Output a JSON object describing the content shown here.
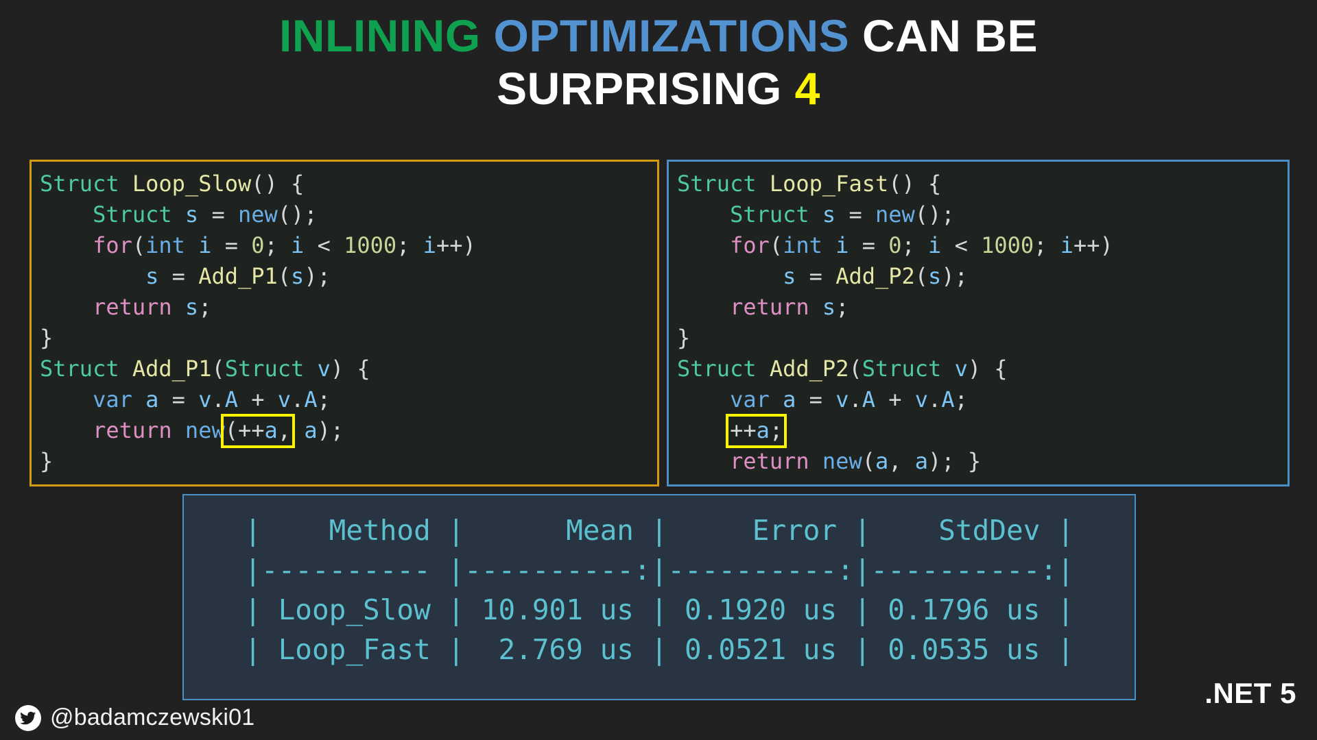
{
  "slide": {
    "title": {
      "line1_part1": "Inlining",
      "line1_part2": "Optimizations",
      "line1_part3": "Can Be",
      "line2_part1": "Surprising",
      "line2_part2": "4"
    },
    "colors": {
      "background": "#212121",
      "title_green": "#0fa14f",
      "title_blue": "#5292d0",
      "title_white": "#ffffff",
      "title_yellow": "#fcf500",
      "panel_left_border": "#d49a12",
      "panel_right_border": "#4a90c7",
      "highlight_box": "#fcf500",
      "table_text": "#5dc0cf",
      "table_background": "#283442"
    }
  },
  "left_panel": {
    "lines": [
      [
        {
          "t": "Struct",
          "c": "c-type"
        },
        {
          "t": " ",
          "c": "c-plain"
        },
        {
          "t": "Loop_Slow",
          "c": "c-fn"
        },
        {
          "t": "() {",
          "c": "c-punc"
        }
      ],
      [
        {
          "t": "    ",
          "c": "c-plain"
        },
        {
          "t": "Struct",
          "c": "c-type"
        },
        {
          "t": " ",
          "c": "c-plain"
        },
        {
          "t": "s",
          "c": "c-var"
        },
        {
          "t": " = ",
          "c": "c-punc"
        },
        {
          "t": "new",
          "c": "c-kw2"
        },
        {
          "t": "();",
          "c": "c-punc"
        }
      ],
      [
        {
          "t": "    ",
          "c": "c-plain"
        },
        {
          "t": "for",
          "c": "c-kw"
        },
        {
          "t": "(",
          "c": "c-punc"
        },
        {
          "t": "int",
          "c": "c-kw2"
        },
        {
          "t": " ",
          "c": "c-plain"
        },
        {
          "t": "i",
          "c": "c-var"
        },
        {
          "t": " = ",
          "c": "c-punc"
        },
        {
          "t": "0",
          "c": "c-num"
        },
        {
          "t": "; ",
          "c": "c-punc"
        },
        {
          "t": "i",
          "c": "c-var"
        },
        {
          "t": " < ",
          "c": "c-punc"
        },
        {
          "t": "1000",
          "c": "c-num"
        },
        {
          "t": "; ",
          "c": "c-punc"
        },
        {
          "t": "i",
          "c": "c-var"
        },
        {
          "t": "++)",
          "c": "c-punc"
        }
      ],
      [
        {
          "t": "        ",
          "c": "c-plain"
        },
        {
          "t": "s",
          "c": "c-var"
        },
        {
          "t": " = ",
          "c": "c-punc"
        },
        {
          "t": "Add_P1",
          "c": "c-fn"
        },
        {
          "t": "(",
          "c": "c-punc"
        },
        {
          "t": "s",
          "c": "c-var"
        },
        {
          "t": ");",
          "c": "c-punc"
        }
      ],
      [
        {
          "t": "    ",
          "c": "c-plain"
        },
        {
          "t": "return",
          "c": "c-kw"
        },
        {
          "t": " ",
          "c": "c-plain"
        },
        {
          "t": "s",
          "c": "c-var"
        },
        {
          "t": ";",
          "c": "c-punc"
        }
      ],
      [
        {
          "t": "}",
          "c": "c-punc"
        }
      ],
      [
        {
          "t": "Struct",
          "c": "c-type"
        },
        {
          "t": " ",
          "c": "c-plain"
        },
        {
          "t": "Add_P1",
          "c": "c-fn"
        },
        {
          "t": "(",
          "c": "c-punc"
        },
        {
          "t": "Struct",
          "c": "c-type"
        },
        {
          "t": " ",
          "c": "c-plain"
        },
        {
          "t": "v",
          "c": "c-var"
        },
        {
          "t": ") {",
          "c": "c-punc"
        }
      ],
      [
        {
          "t": "    ",
          "c": "c-plain"
        },
        {
          "t": "var",
          "c": "c-kw2"
        },
        {
          "t": " ",
          "c": "c-plain"
        },
        {
          "t": "a",
          "c": "c-var"
        },
        {
          "t": " = ",
          "c": "c-punc"
        },
        {
          "t": "v",
          "c": "c-var"
        },
        {
          "t": ".",
          "c": "c-punc"
        },
        {
          "t": "A",
          "c": "c-var"
        },
        {
          "t": " + ",
          "c": "c-punc"
        },
        {
          "t": "v",
          "c": "c-var"
        },
        {
          "t": ".",
          "c": "c-punc"
        },
        {
          "t": "A",
          "c": "c-var"
        },
        {
          "t": ";",
          "c": "c-punc"
        }
      ],
      [
        {
          "t": "    ",
          "c": "c-plain"
        },
        {
          "t": "return",
          "c": "c-kw"
        },
        {
          "t": " ",
          "c": "c-plain"
        },
        {
          "t": "new",
          "c": "c-kw2"
        },
        {
          "t": "(++",
          "c": "c-punc",
          "hl": "start"
        },
        {
          "t": "a",
          "c": "c-var",
          "hl": "mid"
        },
        {
          "t": ",",
          "c": "c-punc",
          "hl": "end"
        },
        {
          "t": " ",
          "c": "c-plain"
        },
        {
          "t": "a",
          "c": "c-var"
        },
        {
          "t": ");",
          "c": "c-punc"
        }
      ],
      [
        {
          "t": "}",
          "c": "c-punc"
        }
      ]
    ]
  },
  "right_panel": {
    "lines": [
      [
        {
          "t": "Struct",
          "c": "c-type"
        },
        {
          "t": " ",
          "c": "c-plain"
        },
        {
          "t": "Loop_Fast",
          "c": "c-fn"
        },
        {
          "t": "() {",
          "c": "c-punc"
        }
      ],
      [
        {
          "t": "    ",
          "c": "c-plain"
        },
        {
          "t": "Struct",
          "c": "c-type"
        },
        {
          "t": " ",
          "c": "c-plain"
        },
        {
          "t": "s",
          "c": "c-var"
        },
        {
          "t": " = ",
          "c": "c-punc"
        },
        {
          "t": "new",
          "c": "c-kw2"
        },
        {
          "t": "();",
          "c": "c-punc"
        }
      ],
      [
        {
          "t": "    ",
          "c": "c-plain"
        },
        {
          "t": "for",
          "c": "c-kw"
        },
        {
          "t": "(",
          "c": "c-punc"
        },
        {
          "t": "int",
          "c": "c-kw2"
        },
        {
          "t": " ",
          "c": "c-plain"
        },
        {
          "t": "i",
          "c": "c-var"
        },
        {
          "t": " = ",
          "c": "c-punc"
        },
        {
          "t": "0",
          "c": "c-num"
        },
        {
          "t": "; ",
          "c": "c-punc"
        },
        {
          "t": "i",
          "c": "c-var"
        },
        {
          "t": " < ",
          "c": "c-punc"
        },
        {
          "t": "1000",
          "c": "c-num"
        },
        {
          "t": "; ",
          "c": "c-punc"
        },
        {
          "t": "i",
          "c": "c-var"
        },
        {
          "t": "++)",
          "c": "c-punc"
        }
      ],
      [
        {
          "t": "        ",
          "c": "c-plain"
        },
        {
          "t": "s",
          "c": "c-var"
        },
        {
          "t": " = ",
          "c": "c-punc"
        },
        {
          "t": "Add_P2",
          "c": "c-fn"
        },
        {
          "t": "(",
          "c": "c-punc"
        },
        {
          "t": "s",
          "c": "c-var"
        },
        {
          "t": ");",
          "c": "c-punc"
        }
      ],
      [
        {
          "t": "    ",
          "c": "c-plain"
        },
        {
          "t": "return",
          "c": "c-kw"
        },
        {
          "t": " ",
          "c": "c-plain"
        },
        {
          "t": "s",
          "c": "c-var"
        },
        {
          "t": ";",
          "c": "c-punc"
        }
      ],
      [
        {
          "t": "}",
          "c": "c-punc"
        }
      ],
      [
        {
          "t": "Struct",
          "c": "c-type"
        },
        {
          "t": " ",
          "c": "c-plain"
        },
        {
          "t": "Add_P2",
          "c": "c-fn"
        },
        {
          "t": "(",
          "c": "c-punc"
        },
        {
          "t": "Struct",
          "c": "c-type"
        },
        {
          "t": " ",
          "c": "c-plain"
        },
        {
          "t": "v",
          "c": "c-var"
        },
        {
          "t": ") {",
          "c": "c-punc"
        }
      ],
      [
        {
          "t": "    ",
          "c": "c-plain"
        },
        {
          "t": "var",
          "c": "c-kw2"
        },
        {
          "t": " ",
          "c": "c-plain"
        },
        {
          "t": "a",
          "c": "c-var"
        },
        {
          "t": " = ",
          "c": "c-punc"
        },
        {
          "t": "v",
          "c": "c-var"
        },
        {
          "t": ".",
          "c": "c-punc"
        },
        {
          "t": "A",
          "c": "c-var"
        },
        {
          "t": " + ",
          "c": "c-punc"
        },
        {
          "t": "v",
          "c": "c-var"
        },
        {
          "t": ".",
          "c": "c-punc"
        },
        {
          "t": "A",
          "c": "c-var"
        },
        {
          "t": ";",
          "c": "c-punc"
        }
      ],
      [
        {
          "t": "    ",
          "c": "c-plain"
        },
        {
          "t": "++",
          "c": "c-punc",
          "hl": "start"
        },
        {
          "t": "a",
          "c": "c-var",
          "hl": "mid"
        },
        {
          "t": ";",
          "c": "c-punc",
          "hl": "end"
        }
      ],
      [
        {
          "t": "    ",
          "c": "c-plain"
        },
        {
          "t": "return",
          "c": "c-kw"
        },
        {
          "t": " ",
          "c": "c-plain"
        },
        {
          "t": "new",
          "c": "c-kw2"
        },
        {
          "t": "(",
          "c": "c-punc"
        },
        {
          "t": "a",
          "c": "c-var"
        },
        {
          "t": ", ",
          "c": "c-punc"
        },
        {
          "t": "a",
          "c": "c-var"
        },
        {
          "t": "); }",
          "c": "c-punc"
        }
      ]
    ]
  },
  "results_table": {
    "raw": "|    Method |      Mean |     Error |    StdDev |\n|---------- |----------:|----------:|----------:|\n| Loop_Slow | 10.901 us | 0.1920 us | 0.1796 us |\n| Loop_Fast |  2.769 us | 0.0521 us | 0.0535 us |",
    "columns": [
      "Method",
      "Mean",
      "Error",
      "StdDev"
    ],
    "rows": [
      [
        "Loop_Slow",
        "10.901 us",
        "0.1920 us",
        "0.1796 us"
      ],
      [
        "Loop_Fast",
        "2.769 us",
        "0.0521 us",
        "0.0535 us"
      ]
    ]
  },
  "footer": {
    "twitter_icon": "twitter-bird-icon",
    "handle": "@badamczewski01",
    "framework": ".NET 5"
  }
}
